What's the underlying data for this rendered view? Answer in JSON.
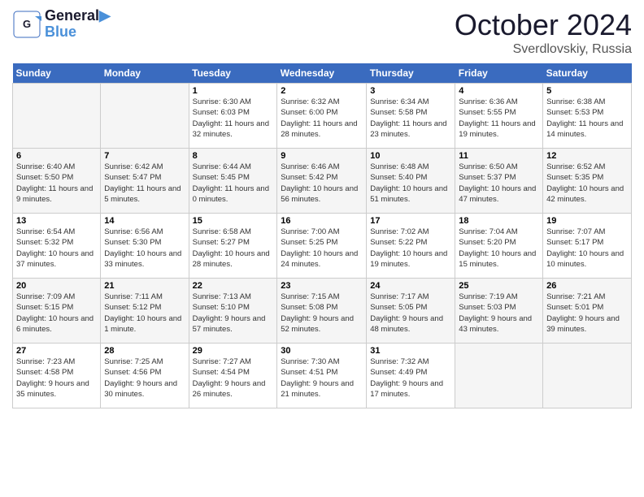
{
  "header": {
    "logo_line1": "General",
    "logo_line2": "Blue",
    "month_title": "October 2024",
    "subtitle": "Sverdlovskiy, Russia"
  },
  "weekdays": [
    "Sunday",
    "Monday",
    "Tuesday",
    "Wednesday",
    "Thursday",
    "Friday",
    "Saturday"
  ],
  "weeks": [
    [
      {
        "day": "",
        "sunrise": "",
        "sunset": "",
        "daylight": ""
      },
      {
        "day": "",
        "sunrise": "",
        "sunset": "",
        "daylight": ""
      },
      {
        "day": "1",
        "sunrise": "Sunrise: 6:30 AM",
        "sunset": "Sunset: 6:03 PM",
        "daylight": "Daylight: 11 hours and 32 minutes."
      },
      {
        "day": "2",
        "sunrise": "Sunrise: 6:32 AM",
        "sunset": "Sunset: 6:00 PM",
        "daylight": "Daylight: 11 hours and 28 minutes."
      },
      {
        "day": "3",
        "sunrise": "Sunrise: 6:34 AM",
        "sunset": "Sunset: 5:58 PM",
        "daylight": "Daylight: 11 hours and 23 minutes."
      },
      {
        "day": "4",
        "sunrise": "Sunrise: 6:36 AM",
        "sunset": "Sunset: 5:55 PM",
        "daylight": "Daylight: 11 hours and 19 minutes."
      },
      {
        "day": "5",
        "sunrise": "Sunrise: 6:38 AM",
        "sunset": "Sunset: 5:53 PM",
        "daylight": "Daylight: 11 hours and 14 minutes."
      }
    ],
    [
      {
        "day": "6",
        "sunrise": "Sunrise: 6:40 AM",
        "sunset": "Sunset: 5:50 PM",
        "daylight": "Daylight: 11 hours and 9 minutes."
      },
      {
        "day": "7",
        "sunrise": "Sunrise: 6:42 AM",
        "sunset": "Sunset: 5:47 PM",
        "daylight": "Daylight: 11 hours and 5 minutes."
      },
      {
        "day": "8",
        "sunrise": "Sunrise: 6:44 AM",
        "sunset": "Sunset: 5:45 PM",
        "daylight": "Daylight: 11 hours and 0 minutes."
      },
      {
        "day": "9",
        "sunrise": "Sunrise: 6:46 AM",
        "sunset": "Sunset: 5:42 PM",
        "daylight": "Daylight: 10 hours and 56 minutes."
      },
      {
        "day": "10",
        "sunrise": "Sunrise: 6:48 AM",
        "sunset": "Sunset: 5:40 PM",
        "daylight": "Daylight: 10 hours and 51 minutes."
      },
      {
        "day": "11",
        "sunrise": "Sunrise: 6:50 AM",
        "sunset": "Sunset: 5:37 PM",
        "daylight": "Daylight: 10 hours and 47 minutes."
      },
      {
        "day": "12",
        "sunrise": "Sunrise: 6:52 AM",
        "sunset": "Sunset: 5:35 PM",
        "daylight": "Daylight: 10 hours and 42 minutes."
      }
    ],
    [
      {
        "day": "13",
        "sunrise": "Sunrise: 6:54 AM",
        "sunset": "Sunset: 5:32 PM",
        "daylight": "Daylight: 10 hours and 37 minutes."
      },
      {
        "day": "14",
        "sunrise": "Sunrise: 6:56 AM",
        "sunset": "Sunset: 5:30 PM",
        "daylight": "Daylight: 10 hours and 33 minutes."
      },
      {
        "day": "15",
        "sunrise": "Sunrise: 6:58 AM",
        "sunset": "Sunset: 5:27 PM",
        "daylight": "Daylight: 10 hours and 28 minutes."
      },
      {
        "day": "16",
        "sunrise": "Sunrise: 7:00 AM",
        "sunset": "Sunset: 5:25 PM",
        "daylight": "Daylight: 10 hours and 24 minutes."
      },
      {
        "day": "17",
        "sunrise": "Sunrise: 7:02 AM",
        "sunset": "Sunset: 5:22 PM",
        "daylight": "Daylight: 10 hours and 19 minutes."
      },
      {
        "day": "18",
        "sunrise": "Sunrise: 7:04 AM",
        "sunset": "Sunset: 5:20 PM",
        "daylight": "Daylight: 10 hours and 15 minutes."
      },
      {
        "day": "19",
        "sunrise": "Sunrise: 7:07 AM",
        "sunset": "Sunset: 5:17 PM",
        "daylight": "Daylight: 10 hours and 10 minutes."
      }
    ],
    [
      {
        "day": "20",
        "sunrise": "Sunrise: 7:09 AM",
        "sunset": "Sunset: 5:15 PM",
        "daylight": "Daylight: 10 hours and 6 minutes."
      },
      {
        "day": "21",
        "sunrise": "Sunrise: 7:11 AM",
        "sunset": "Sunset: 5:12 PM",
        "daylight": "Daylight: 10 hours and 1 minute."
      },
      {
        "day": "22",
        "sunrise": "Sunrise: 7:13 AM",
        "sunset": "Sunset: 5:10 PM",
        "daylight": "Daylight: 9 hours and 57 minutes."
      },
      {
        "day": "23",
        "sunrise": "Sunrise: 7:15 AM",
        "sunset": "Sunset: 5:08 PM",
        "daylight": "Daylight: 9 hours and 52 minutes."
      },
      {
        "day": "24",
        "sunrise": "Sunrise: 7:17 AM",
        "sunset": "Sunset: 5:05 PM",
        "daylight": "Daylight: 9 hours and 48 minutes."
      },
      {
        "day": "25",
        "sunrise": "Sunrise: 7:19 AM",
        "sunset": "Sunset: 5:03 PM",
        "daylight": "Daylight: 9 hours and 43 minutes."
      },
      {
        "day": "26",
        "sunrise": "Sunrise: 7:21 AM",
        "sunset": "Sunset: 5:01 PM",
        "daylight": "Daylight: 9 hours and 39 minutes."
      }
    ],
    [
      {
        "day": "27",
        "sunrise": "Sunrise: 7:23 AM",
        "sunset": "Sunset: 4:58 PM",
        "daylight": "Daylight: 9 hours and 35 minutes."
      },
      {
        "day": "28",
        "sunrise": "Sunrise: 7:25 AM",
        "sunset": "Sunset: 4:56 PM",
        "daylight": "Daylight: 9 hours and 30 minutes."
      },
      {
        "day": "29",
        "sunrise": "Sunrise: 7:27 AM",
        "sunset": "Sunset: 4:54 PM",
        "daylight": "Daylight: 9 hours and 26 minutes."
      },
      {
        "day": "30",
        "sunrise": "Sunrise: 7:30 AM",
        "sunset": "Sunset: 4:51 PM",
        "daylight": "Daylight: 9 hours and 21 minutes."
      },
      {
        "day": "31",
        "sunrise": "Sunrise: 7:32 AM",
        "sunset": "Sunset: 4:49 PM",
        "daylight": "Daylight: 9 hours and 17 minutes."
      },
      {
        "day": "",
        "sunrise": "",
        "sunset": "",
        "daylight": ""
      },
      {
        "day": "",
        "sunrise": "",
        "sunset": "",
        "daylight": ""
      }
    ]
  ]
}
